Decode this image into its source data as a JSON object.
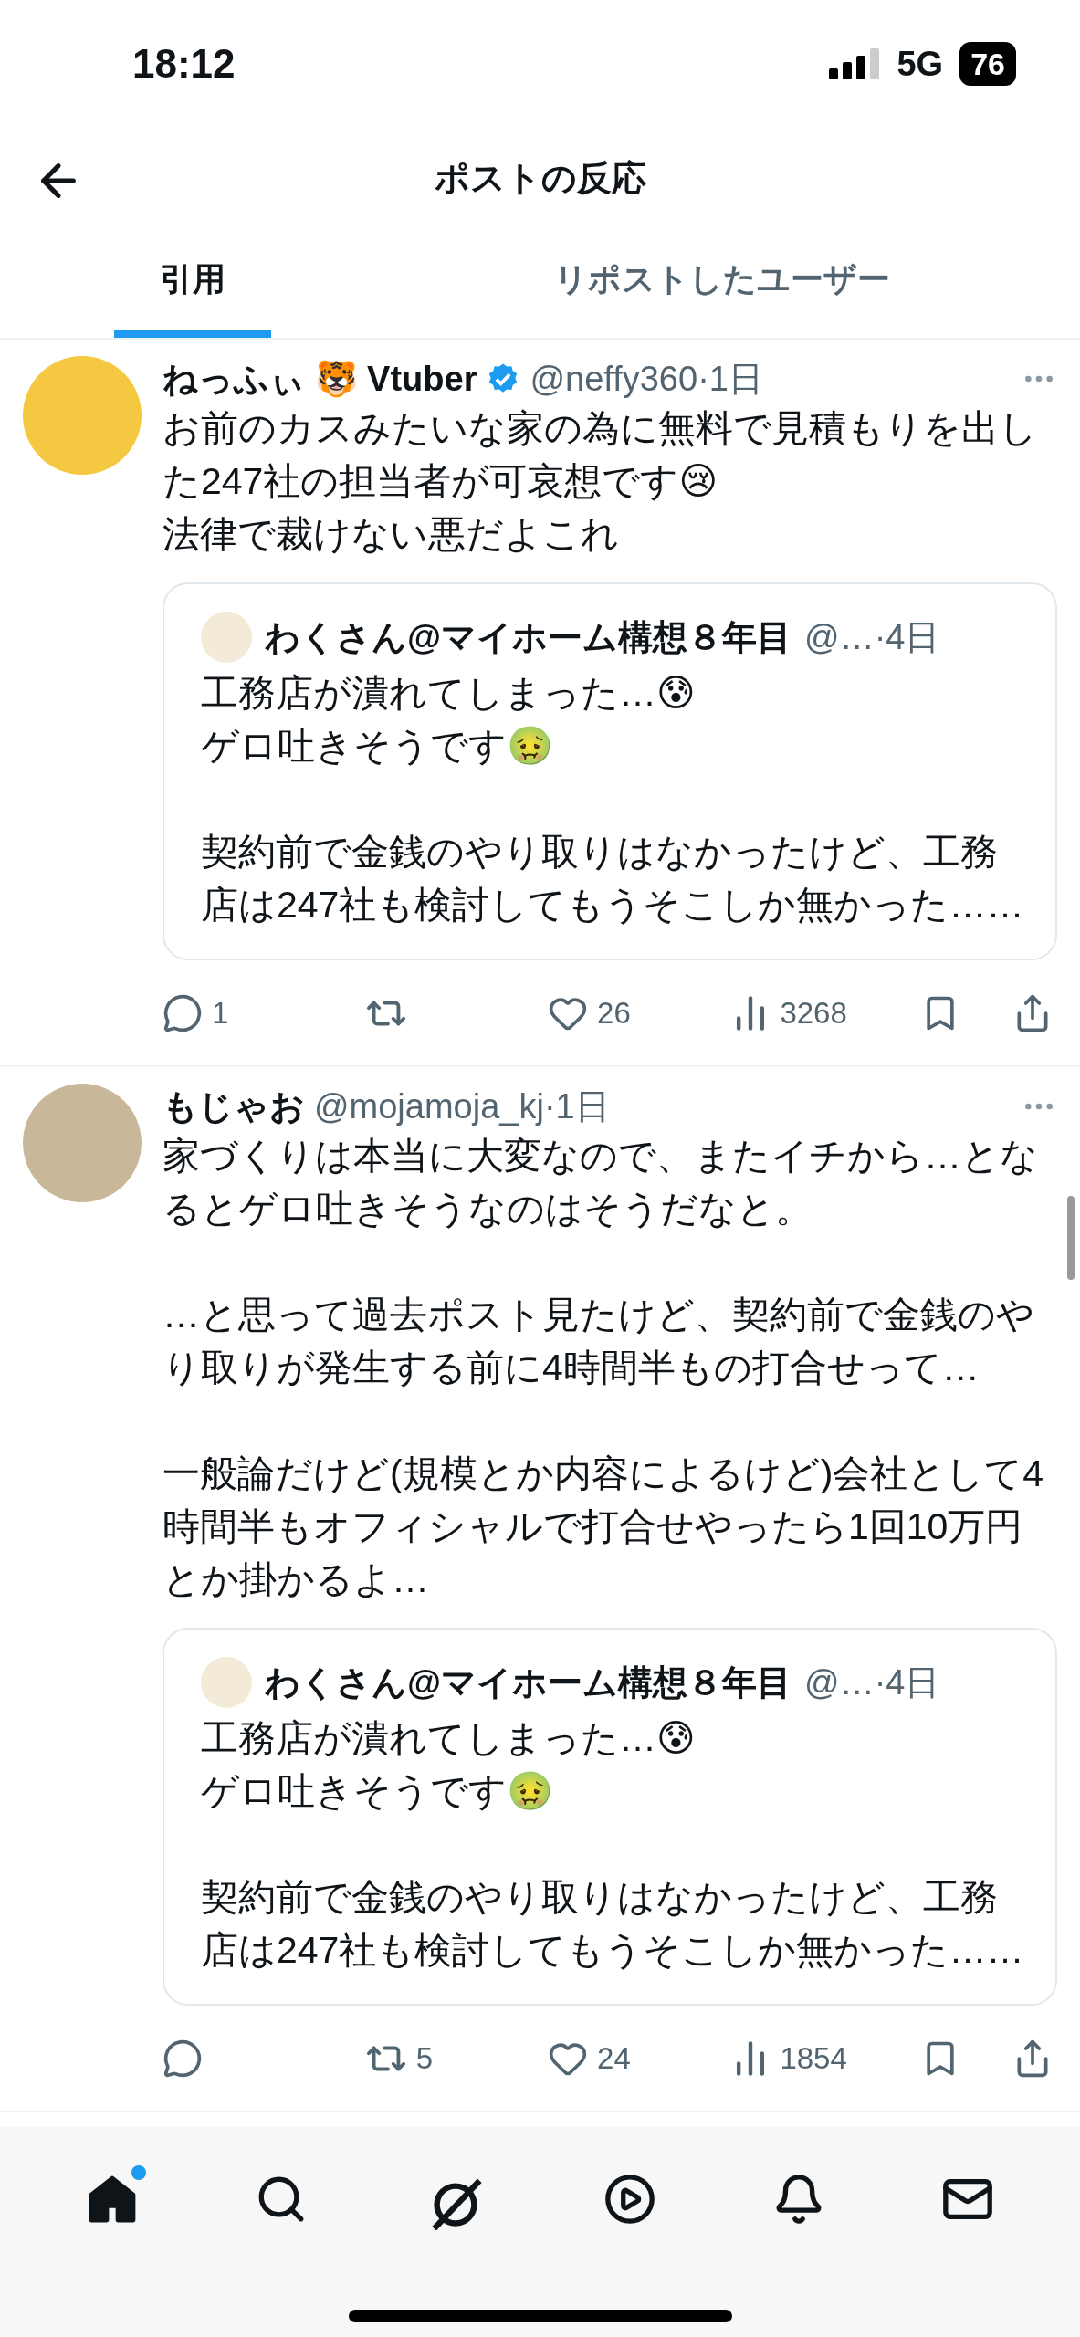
{
  "status_bar": {
    "time": "18:12",
    "network": "5G",
    "battery": "76"
  },
  "header": {
    "title": "ポストの反応"
  },
  "tabs": [
    {
      "label": "引用",
      "selected": true
    },
    {
      "label": "リポストしたユーザー",
      "selected": false
    }
  ],
  "posts": [
    {
      "display_name": "ねっふぃ 🐯 Vtuber",
      "verified": true,
      "meta": "@neffy360·1日",
      "body": "お前のカスみたいな家の為に無料で見積もりを出した247社の担当者が可哀想です😢\n法律で裁けない悪だよこれ",
      "quote": {
        "display_name": "わくさん@マイホーム構想８年目",
        "meta": "@…·4日",
        "body": "工務店が潰れてしまった…😰\nゲロ吐きそうです🤢\n\n契約前で金銭のやり取りはなかったけど、工務店は247社も検討してもうそこしか無かった……"
      },
      "stats": {
        "replies": "1",
        "likes": "26",
        "views": "3268"
      }
    },
    {
      "display_name": "もじゃお",
      "verified": false,
      "meta": "@mojamoja_kj·1日",
      "body": "家づくりは本当に大変なので、またイチから…となるとゲロ吐きそうなのはそうだなと。\n\n…と思って過去ポスト見たけど、契約前で金銭のやり取りが発生する前に4時間半もの打合せって…\n\n一般論だけど(規模とか内容によるけど)会社として4時間半もオフィシャルで打合せやったら1回10万円とか掛かるよ…",
      "quote": {
        "display_name": "わくさん@マイホーム構想８年目",
        "meta": "@…·4日",
        "body": "工務店が潰れてしまった…😰\nゲロ吐きそうです🤢\n\n契約前で金銭のやり取りはなかったけど、工務店は247社も検討してもうそこしか無かった……"
      },
      "stats": {
        "reposts": "5",
        "likes": "24",
        "views": "1854"
      }
    }
  ],
  "bottom_nav": [
    {
      "kind": "home",
      "selected": true,
      "dot": true
    },
    {
      "kind": "search",
      "selected": false,
      "dot": false
    },
    {
      "kind": "grok",
      "selected": false,
      "dot": false
    },
    {
      "kind": "video",
      "selected": false,
      "dot": false
    },
    {
      "kind": "notifications",
      "selected": false,
      "dot": false
    },
    {
      "kind": "messages",
      "selected": false,
      "dot": false
    }
  ]
}
